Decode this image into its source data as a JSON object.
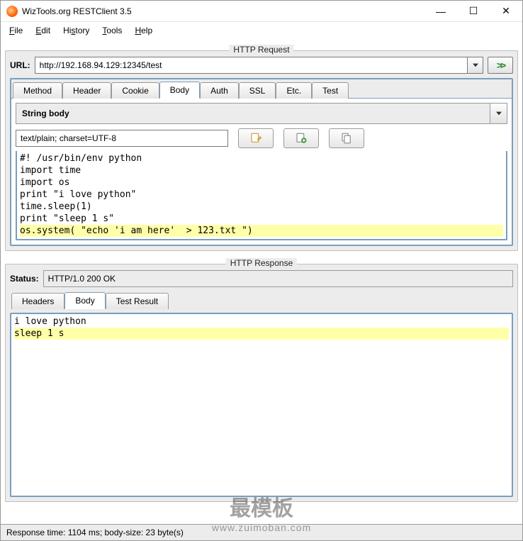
{
  "window": {
    "title": "WizTools.org RESTClient 3.5"
  },
  "menubar": {
    "file": "File",
    "edit": "Edit",
    "history": "History",
    "tools": "Tools",
    "help": "Help"
  },
  "request": {
    "panel_title": "HTTP Request",
    "url_label": "URL:",
    "url_value": "http://192.168.94.129:12345/test",
    "go_glyph": "❯❯",
    "tabs": [
      "Method",
      "Header",
      "Cookie",
      "Body",
      "Auth",
      "SSL",
      "Etc.",
      "Test"
    ],
    "active_tab_index": 3,
    "body_type": "String body",
    "content_type": "text/plain; charset=UTF-8",
    "code_lines": [
      "#! /usr/bin/env python",
      "import time",
      "import os",
      "print \"i love python\"",
      "time.sleep(1)",
      "print \"sleep 1 s\"",
      "os.system( \"echo 'i am here'  > 123.txt \")"
    ],
    "highlight_line_index": 6
  },
  "response": {
    "panel_title": "HTTP Response",
    "status_label": "Status:",
    "status_value": "HTTP/1.0 200 OK",
    "tabs": [
      "Headers",
      "Body",
      "Test Result"
    ],
    "active_tab_index": 1,
    "body_lines": [
      "i love python",
      "sleep 1 s"
    ],
    "highlight_line_index": 1
  },
  "statusbar": {
    "text": "Response time: 1104 ms; body-size: 23 byte(s)"
  },
  "watermark": {
    "big": "最模板",
    "small": "www.zuimoban.com"
  }
}
